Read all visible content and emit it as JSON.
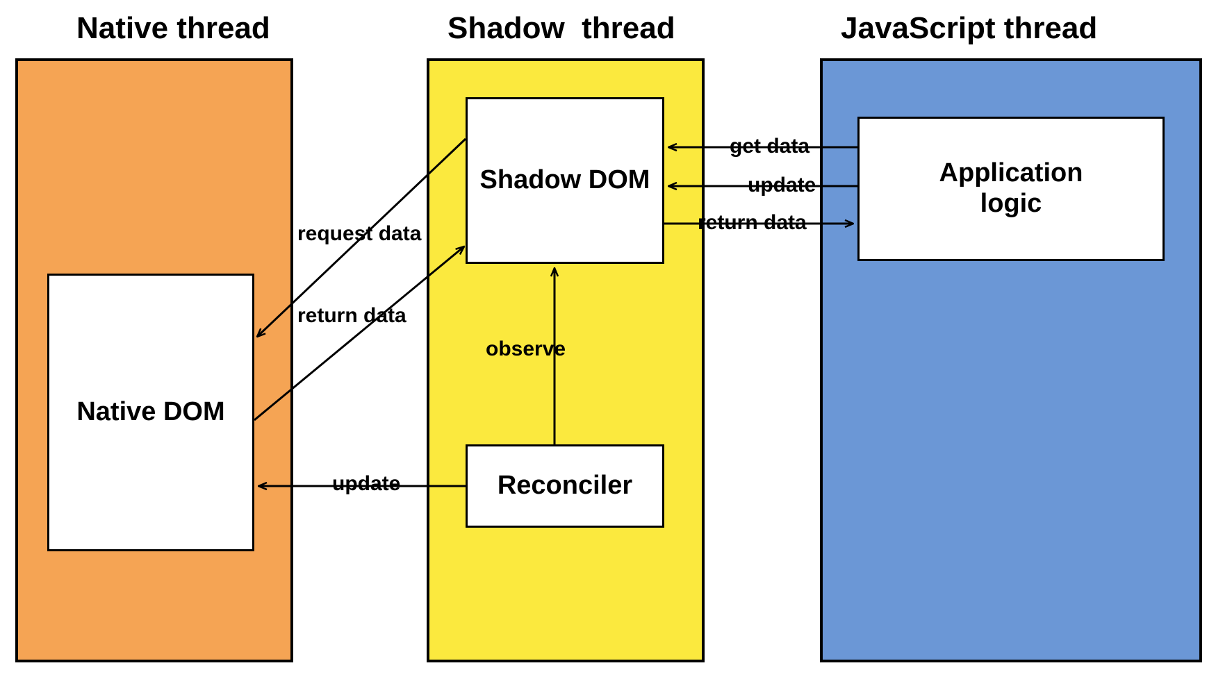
{
  "columns": {
    "native": {
      "title": "Native thread",
      "color": "#f5a454"
    },
    "shadow": {
      "title": "Shadow  thread",
      "color": "#fbe93e"
    },
    "js": {
      "title": "JavaScript thread",
      "color": "#6b97d6"
    }
  },
  "nodes": {
    "native_dom": {
      "label": "Native DOM"
    },
    "shadow_dom": {
      "label": "Shadow DOM"
    },
    "reconciler": {
      "label": "Reconciler"
    },
    "app_logic": {
      "label": "Application\nlogic"
    }
  },
  "edges": {
    "request_data": {
      "label": "request data",
      "from": "shadow_dom",
      "to": "native_dom"
    },
    "return_data_native": {
      "label": "return data",
      "from": "native_dom",
      "to": "shadow_dom"
    },
    "observe": {
      "label": "observe",
      "from": "reconciler",
      "to": "shadow_dom"
    },
    "update_native": {
      "label": "update",
      "from": "reconciler",
      "to": "native_dom"
    },
    "get_data": {
      "label": "get data",
      "from": "app_logic",
      "to": "shadow_dom"
    },
    "update_shadow": {
      "label": "update",
      "from": "app_logic",
      "to": "shadow_dom"
    },
    "return_data_js": {
      "label": "return data",
      "from": "shadow_dom",
      "to": "app_logic"
    }
  }
}
